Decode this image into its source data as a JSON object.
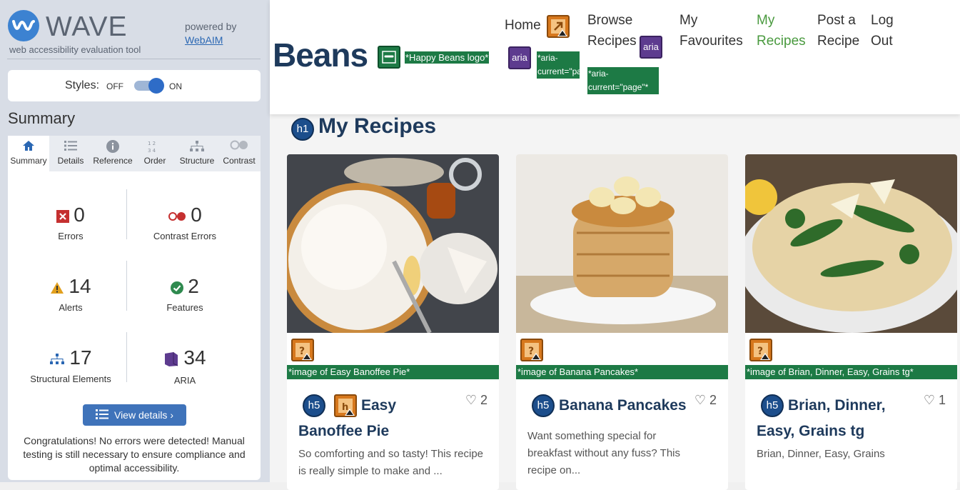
{
  "wave": {
    "name": "WAVE",
    "tagline": "web accessibility evaluation tool",
    "powered_by": "powered by",
    "webaim_link": "WebAIM",
    "styles_label": "Styles:",
    "styles_off": "OFF",
    "styles_on": "ON",
    "summary_heading": "Summary",
    "tabs": [
      {
        "label": "Summary",
        "icon": "home-icon"
      },
      {
        "label": "Details",
        "icon": "list-icon"
      },
      {
        "label": "Reference",
        "icon": "info-icon"
      },
      {
        "label": "Order",
        "icon": "order-icon"
      },
      {
        "label": "Structure",
        "icon": "structure-icon"
      },
      {
        "label": "Contrast",
        "icon": "contrast-icon"
      }
    ],
    "stats": {
      "errors": {
        "value": "0",
        "label": "Errors"
      },
      "contrast_errors": {
        "value": "0",
        "label": "Contrast Errors"
      },
      "alerts": {
        "value": "14",
        "label": "Alerts"
      },
      "features": {
        "value": "2",
        "label": "Features"
      },
      "structural": {
        "value": "17",
        "label": "Structural Elements"
      },
      "aria": {
        "value": "34",
        "label": "ARIA"
      }
    },
    "view_details": "View details ›",
    "congrats": "Congratulations! No errors were detected! Manual testing is still necessary to ensure compliance and optimal accessibility."
  },
  "site": {
    "brand": "Beans",
    "logo_alt_tag": "*Happy Beans logo*",
    "aria_badge": "aria",
    "aria_current_tag": "*aria-current=\"page\"*",
    "nav": [
      {
        "label": "Home"
      },
      {
        "label": "Browse Recipes"
      },
      {
        "label": "My Favourites"
      },
      {
        "label": "My Recipes",
        "current": true
      },
      {
        "label": "Post a Recipe"
      },
      {
        "label": "Log Out"
      }
    ],
    "h1_badge": "h1",
    "h5_badge": "h5",
    "page_title": "My Recipes",
    "cards": [
      {
        "alt_tag": "*image of Easy Banoffee Pie*",
        "title": "Easy Banoffee Pie",
        "likes": "2",
        "description": "So comforting and so tasty! This recipe is really simple to make and ..."
      },
      {
        "alt_tag": "*image of Banana Pancakes*",
        "title": "Banana Pancakes",
        "likes": "2",
        "description": "Want something special for breakfast without any fuss? This recipe on..."
      },
      {
        "alt_tag": "*image of Brian, Dinner, Easy, Grains tg*",
        "title": "Brian, Dinner, Easy, Grains tg",
        "likes": "1",
        "description": "Brian, Dinner, Easy, Grains"
      }
    ]
  },
  "colors": {
    "wave_panel": "#d8dde6",
    "brand_navy": "#1e3a5c",
    "current_nav": "#4a9a3f",
    "wave_green_tag": "#1d7a45"
  }
}
